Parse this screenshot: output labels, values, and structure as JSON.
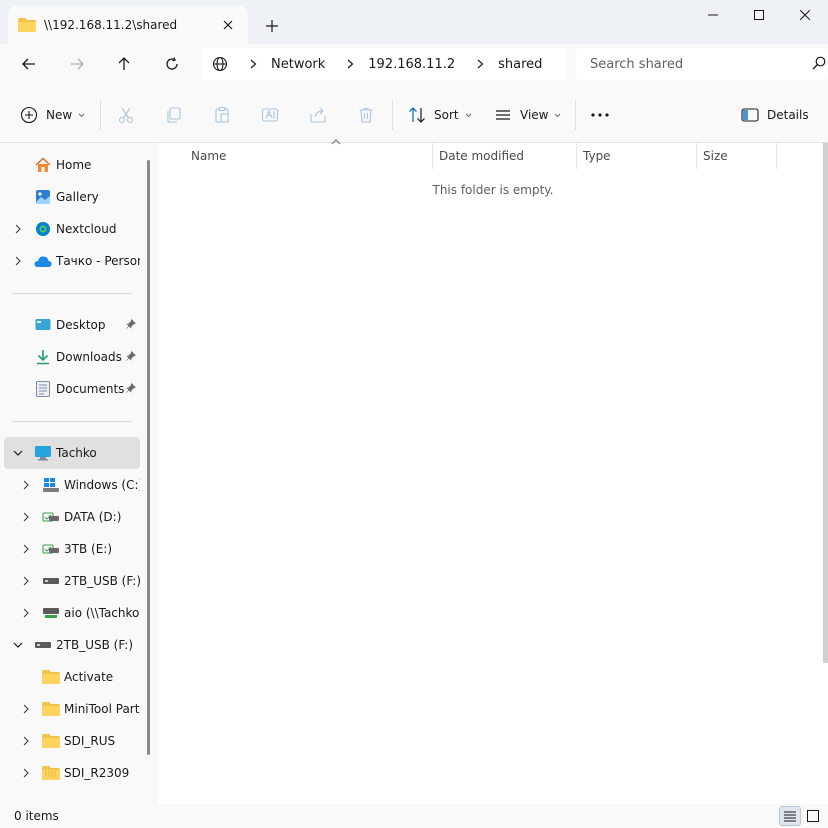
{
  "tab": {
    "title": "\\\\192.168.11.2\\shared"
  },
  "breadcrumb": [
    "Network",
    "192.168.11.2",
    "shared"
  ],
  "search": {
    "placeholder": "Search shared"
  },
  "toolbar": {
    "new_label": "New",
    "sort_label": "Sort",
    "view_label": "View",
    "details_label": "Details"
  },
  "sidebar": {
    "quick": [
      {
        "label": "Home",
        "icon": "home-icon"
      },
      {
        "label": "Gallery",
        "icon": "gallery-icon"
      },
      {
        "label": "Nextcloud",
        "icon": "nextcloud-icon"
      },
      {
        "label": "Тачко - Persona",
        "icon": "onedrive-icon"
      }
    ],
    "pinned": [
      {
        "label": "Desktop",
        "icon": "desktop-icon"
      },
      {
        "label": "Downloads",
        "icon": "downloads-icon"
      },
      {
        "label": "Documents",
        "icon": "documents-icon"
      }
    ],
    "pc": {
      "label": "Tachko",
      "icon": "computer-icon"
    },
    "drives": [
      {
        "label": "Windows (C:)",
        "icon": "windows-drive-icon"
      },
      {
        "label": "DATA (D:)",
        "icon": "drive-icon"
      },
      {
        "label": "3TB (E:)",
        "icon": "drive-icon"
      },
      {
        "label": "2TB_USB (F:)",
        "icon": "usb-drive-icon"
      },
      {
        "label": "aio (\\\\Tachko-",
        "icon": "network-drive-icon"
      }
    ],
    "usb": {
      "label": "2TB_USB (F:)",
      "icon": "usb-drive-icon"
    },
    "usb_folders": [
      {
        "label": "Activate",
        "icon": "folder-icon"
      },
      {
        "label": "MiniTool Partit",
        "icon": "folder-icon"
      },
      {
        "label": "SDI_RUS",
        "icon": "folder-icon"
      },
      {
        "label": "SDI_R2309",
        "icon": "zip-folder-icon"
      }
    ]
  },
  "columns": [
    "Name",
    "Date modified",
    "Type",
    "Size"
  ],
  "content": {
    "empty_message": "This folder is empty."
  },
  "status": {
    "items": "0 items"
  },
  "colors": {
    "folder": "#f4c24a",
    "accent": "#0067c0",
    "selected": "#e0e0e0"
  }
}
